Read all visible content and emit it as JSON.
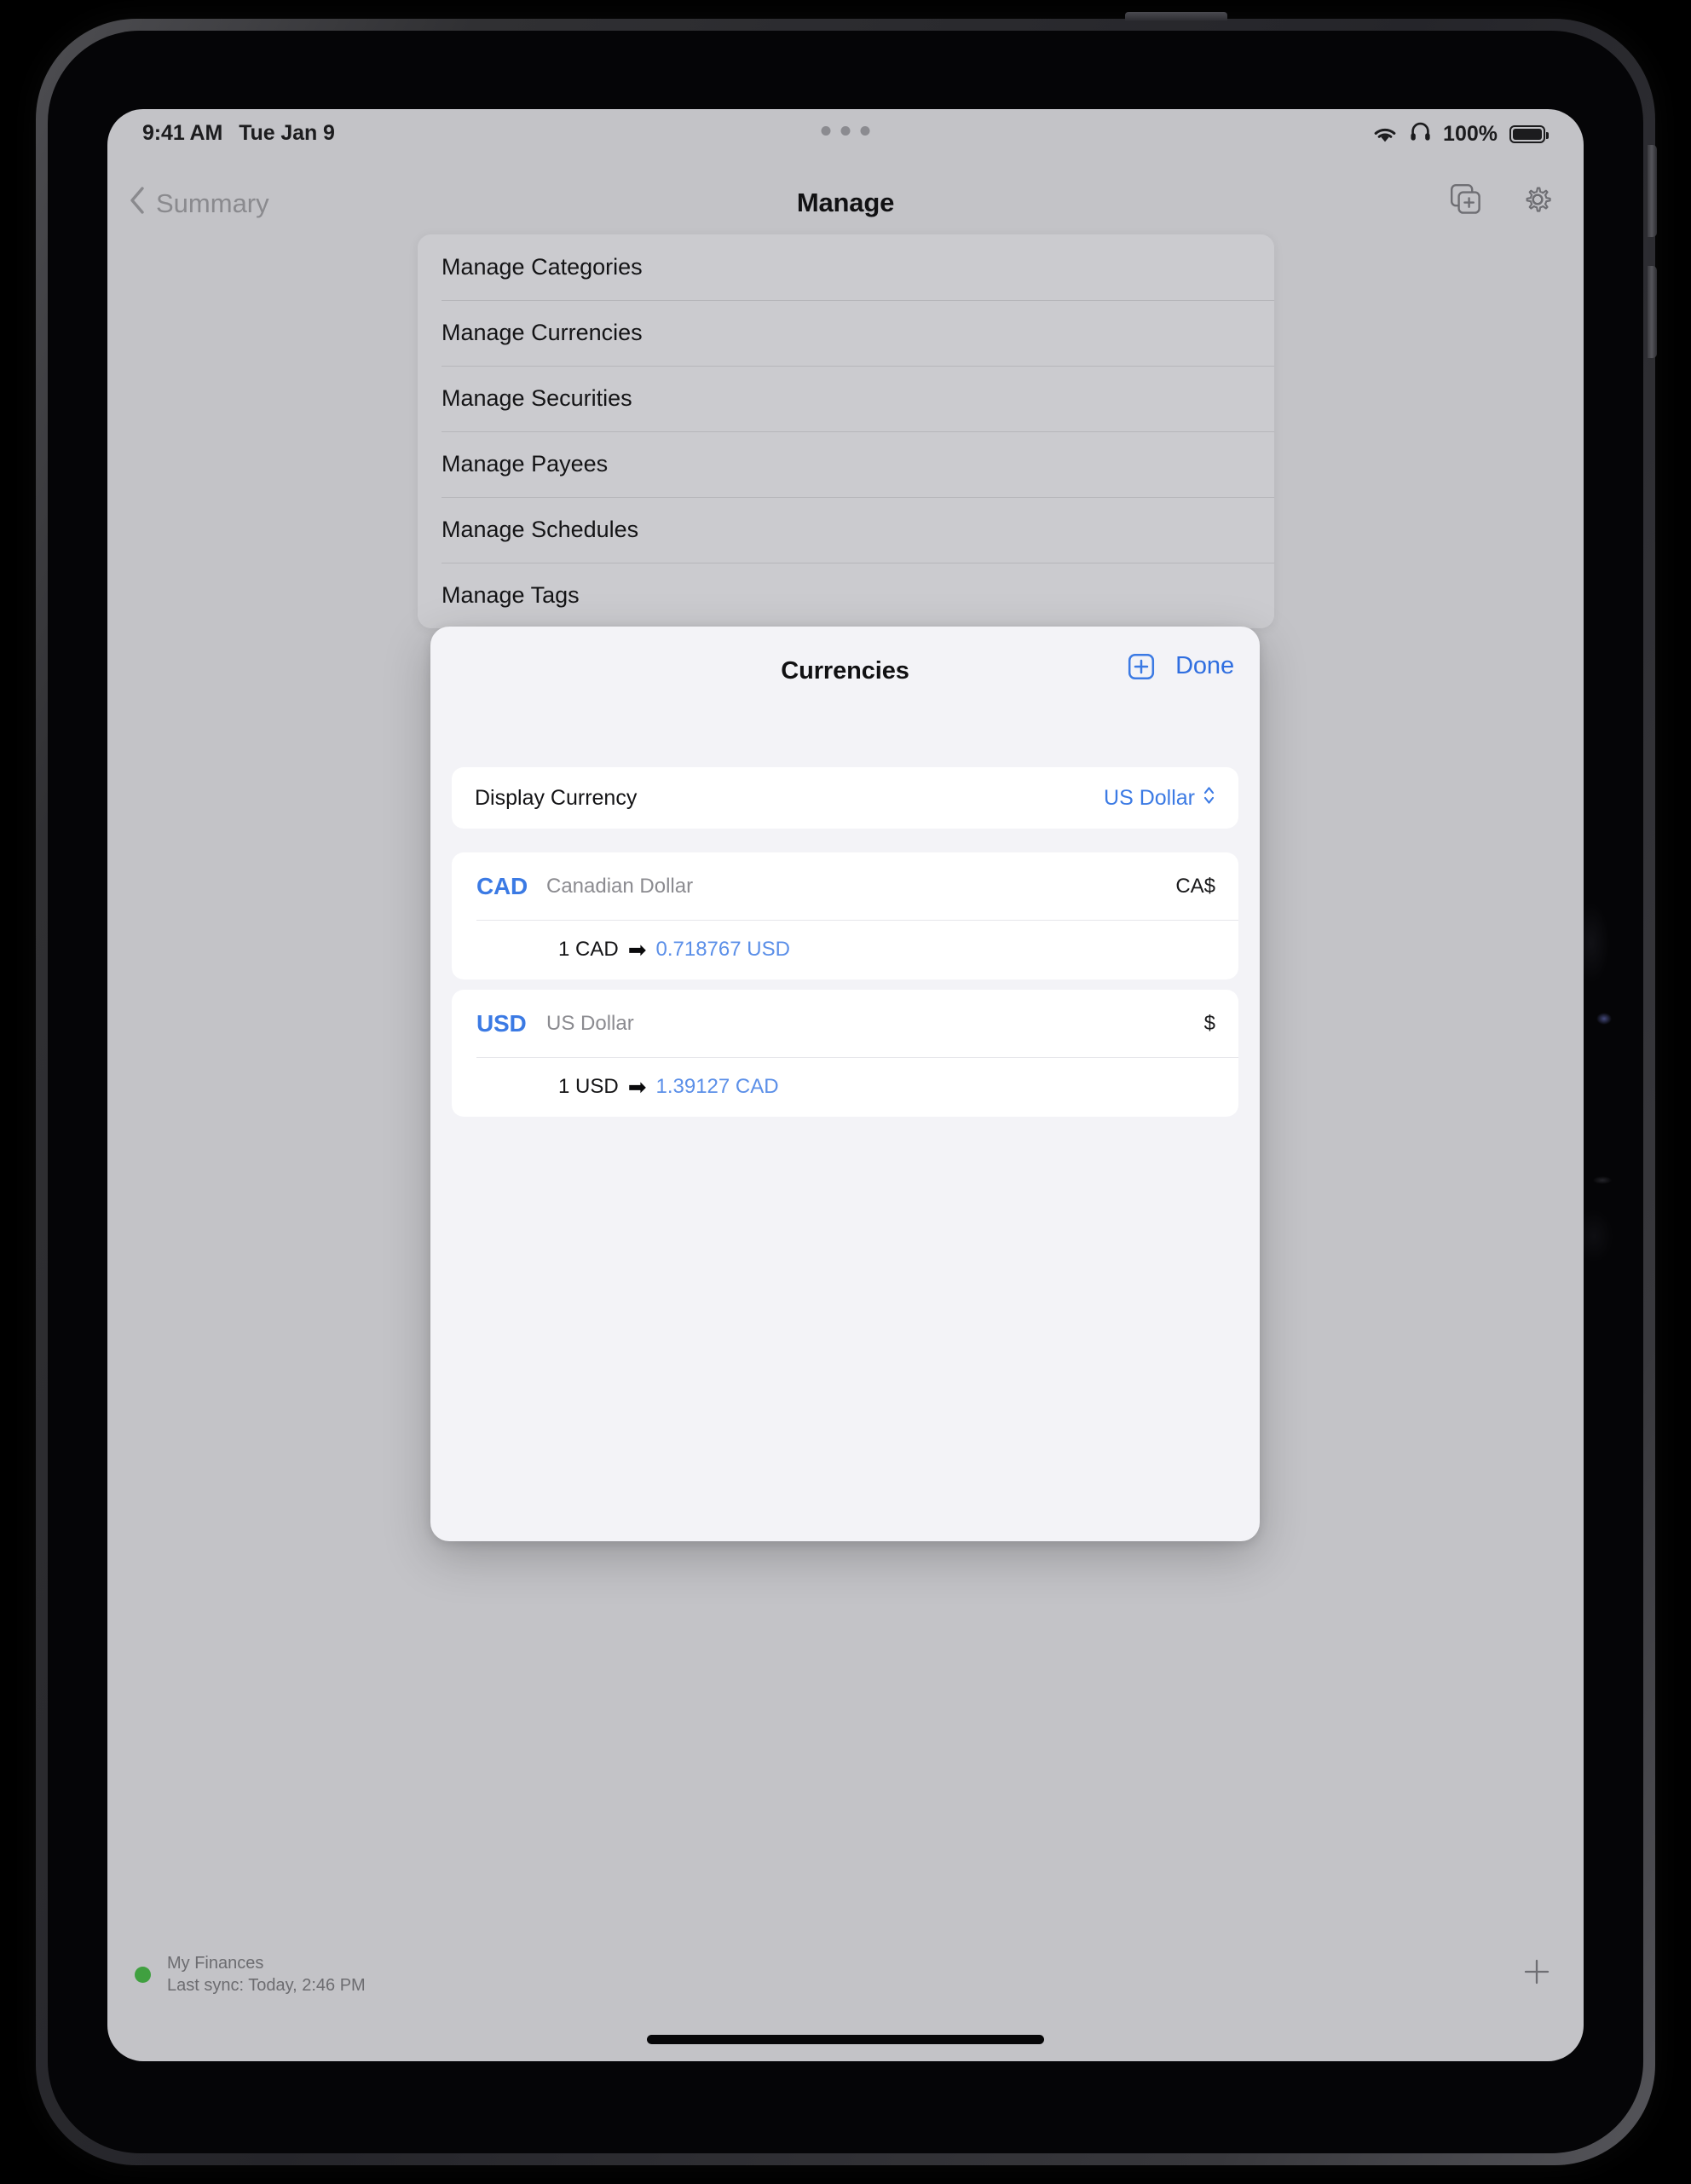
{
  "status_bar": {
    "time": "9:41 AM",
    "date": "Tue Jan 9",
    "battery_percent": "100%",
    "wifi_icon": "wifi-icon",
    "headphones_icon": "headphones-icon",
    "battery_icon": "battery-icon",
    "multitask_handle": "multitask-dots-icon"
  },
  "nav_bar": {
    "back_label": "Summary",
    "back_icon": "chevron-left-icon",
    "title": "Manage",
    "new_window_icon": "new-window-icon",
    "settings_icon": "gear-icon"
  },
  "manage_menu": {
    "items": [
      {
        "label": "Manage Categories"
      },
      {
        "label": "Manage Currencies"
      },
      {
        "label": "Manage Securities"
      },
      {
        "label": "Manage Payees"
      },
      {
        "label": "Manage Schedules"
      },
      {
        "label": "Manage Tags"
      }
    ]
  },
  "modal": {
    "title": "Currencies",
    "add_icon": "plus-square-icon",
    "done_label": "Done",
    "display_currency": {
      "label": "Display Currency",
      "value": "US Dollar",
      "chevron_icon": "chevron-up-down-icon"
    },
    "currencies": [
      {
        "code": "CAD",
        "name": "Canadian Dollar",
        "symbol": "CA$",
        "rate_from": "1 CAD",
        "rate_arrow": "➡",
        "rate_to": "0.718767 USD"
      },
      {
        "code": "USD",
        "name": "US Dollar",
        "symbol": "$",
        "rate_from": "1 USD",
        "rate_arrow": "➡",
        "rate_to": "1.39127 CAD"
      }
    ]
  },
  "app_status_bar": {
    "file_name": "My Finances",
    "last_sync": "Last sync: Today, 2:46 PM",
    "sync_indicator_color": "#40a040",
    "add_icon": "plus-icon"
  },
  "colors": {
    "accent_blue": "#3b7ae4",
    "done_blue": "#2f6ee0",
    "screen_background": "#c3c3c7",
    "menu_background": "#cbcbcf",
    "modal_background": "#f3f3f7",
    "card_background": "#ffffff",
    "muted_text": "#8b8b90"
  }
}
